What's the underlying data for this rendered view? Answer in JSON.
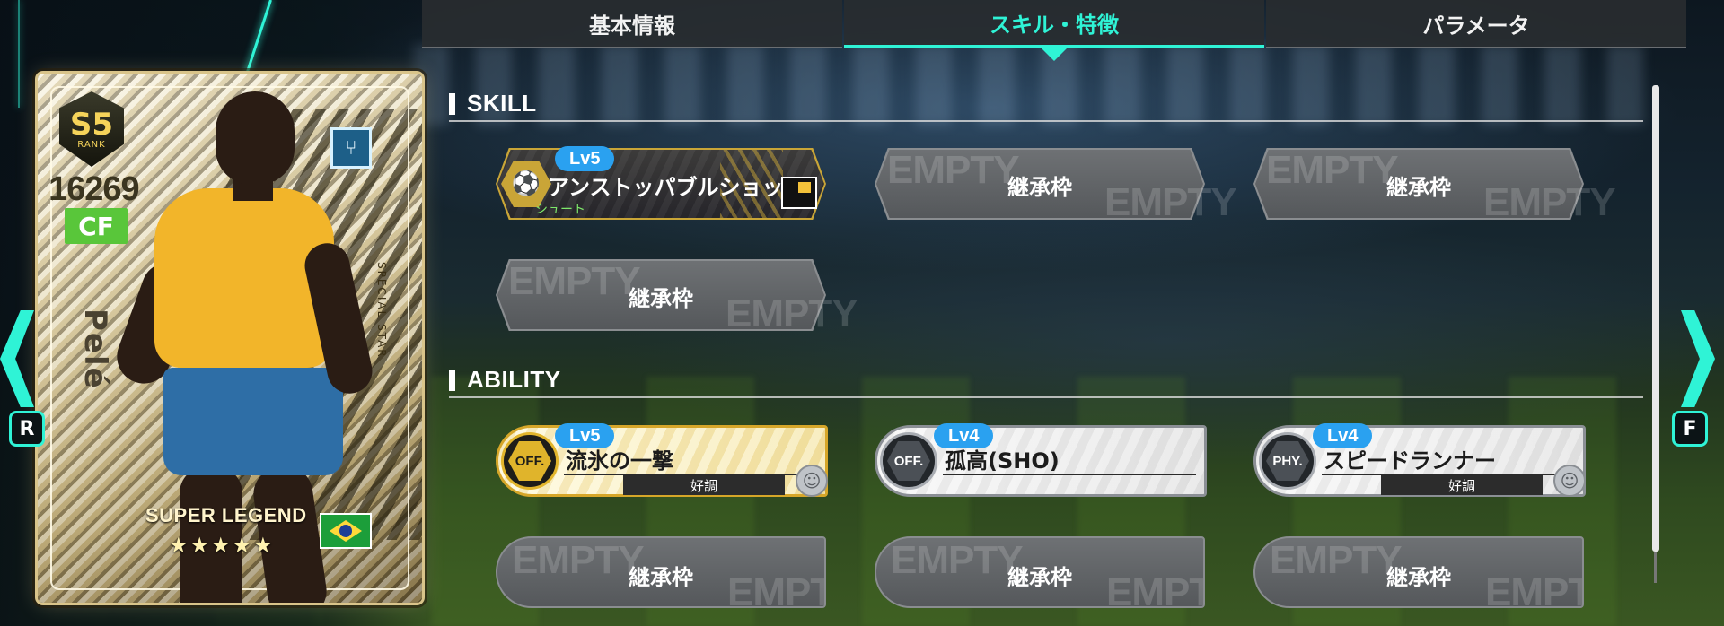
{
  "tabs": [
    {
      "label": "基本情報",
      "active": false
    },
    {
      "label": "スキル・特徴",
      "active": true
    },
    {
      "label": "パラメータ",
      "active": false
    }
  ],
  "card": {
    "rank": "S5",
    "rank_sub": "RANK",
    "overall": "16269",
    "position": "CF",
    "player_name": "Pelé",
    "edition": "SPECIAL STAR",
    "card_type": "SUPER LEGEND",
    "stars": "★★★★★",
    "rating_stars": 5,
    "nationality_flag": "brazil-flag",
    "play_style_icon": "play-style-icon"
  },
  "nav": {
    "left_key": "R",
    "right_key": "F"
  },
  "skill": {
    "heading": "SKILL",
    "active_skill": {
      "level": "Lv5",
      "name": "アンストッパブルショット",
      "category": "シュート",
      "icon": "shoot-icon"
    },
    "empty_label": "継承枠",
    "empty_watermark": "EMPTY"
  },
  "ability": {
    "heading": "ABILITY",
    "items": [
      {
        "level": "Lv5",
        "badge": "OFF.",
        "name": "流氷の一撃",
        "status": "好調",
        "gold": true
      },
      {
        "level": "Lv4",
        "badge": "OFF.",
        "name": "孤高(SHO)",
        "status": "",
        "gold": false
      },
      {
        "level": "Lv4",
        "badge": "PHY.",
        "name": "スピードランナー",
        "status": "好調",
        "gold": false
      }
    ],
    "empty_label": "継承枠",
    "empty_watermark": "EMPTY"
  },
  "colors": {
    "accent": "#2ff3d6",
    "gold": "#c9a537",
    "level_pill": "#2aa1f0",
    "position_badge": "#59c63a"
  }
}
